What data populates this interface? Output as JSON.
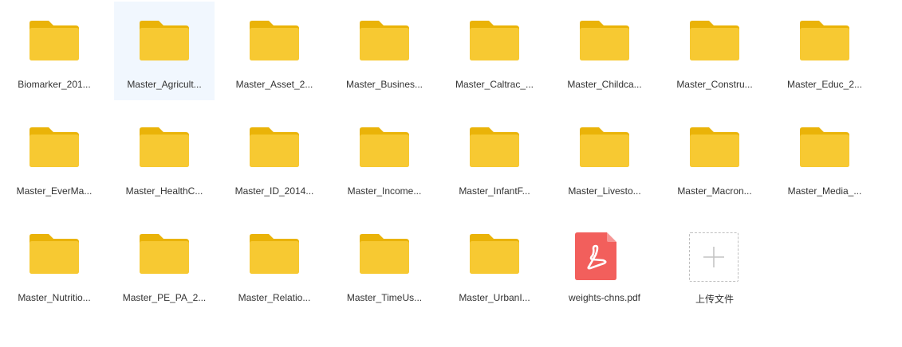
{
  "files": [
    {
      "name": "Biomarker_201...",
      "type": "folder"
    },
    {
      "name": "Master_Agricult...",
      "type": "folder",
      "selected": true
    },
    {
      "name": "Master_Asset_2...",
      "type": "folder"
    },
    {
      "name": "Master_Busines...",
      "type": "folder"
    },
    {
      "name": "Master_Caltrac_...",
      "type": "folder"
    },
    {
      "name": "Master_Childca...",
      "type": "folder"
    },
    {
      "name": "Master_Constru...",
      "type": "folder"
    },
    {
      "name": "Master_Educ_2...",
      "type": "folder"
    },
    {
      "name": "Master_EverMa...",
      "type": "folder"
    },
    {
      "name": "Master_HealthC...",
      "type": "folder"
    },
    {
      "name": "Master_ID_2014...",
      "type": "folder"
    },
    {
      "name": "Master_Income...",
      "type": "folder"
    },
    {
      "name": "Master_InfantF...",
      "type": "folder"
    },
    {
      "name": "Master_Livesto...",
      "type": "folder"
    },
    {
      "name": "Master_Macron...",
      "type": "folder"
    },
    {
      "name": "Master_Media_...",
      "type": "folder"
    },
    {
      "name": "Master_Nutritio...",
      "type": "folder"
    },
    {
      "name": "Master_PE_PA_2...",
      "type": "folder"
    },
    {
      "name": "Master_Relatio...",
      "type": "folder"
    },
    {
      "name": "Master_TimeUs...",
      "type": "folder"
    },
    {
      "name": "Master_UrbanI...",
      "type": "folder"
    },
    {
      "name": "weights-chns.pdf",
      "type": "pdf"
    }
  ],
  "upload": {
    "label": "上传文件",
    "icon": "plus-icon"
  },
  "colors": {
    "folder_back": "#eab308",
    "folder_front": "#f7c932",
    "pdf": "#f25f5c",
    "selected_bg": "#f1f7fe"
  }
}
